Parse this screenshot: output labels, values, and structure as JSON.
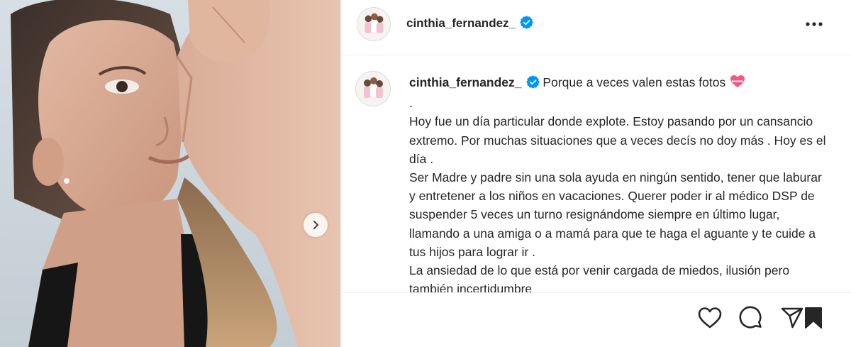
{
  "header": {
    "username": "cinthia_fernandez_",
    "verified": true,
    "avatar_icon": "profile-photo-avatar",
    "more_icon": "more-options-icon"
  },
  "caption": {
    "username": "cinthia_fernandez_",
    "verified": true,
    "first_line": "Porque a veces valen estas fotos",
    "emoji_icon": "heart-ribbon-icon",
    "body": ".\nHoy fue un día particular donde explote. Estoy pasando por un cansancio extremo. Por muchas situaciones que a veces decís no doy más . Hoy es el día .\nSer Madre y padre sin una sola ayuda en ningún sentido, tener que laburar y entretener a los niños en vacaciones. Querer poder ir al médico DSP de suspender 5 veces un turno resignándome siempre en último lugar, llamando a una amiga o a mamá para que te haga el aguante y te cuide a tus hijos para lograr ir .\nLa ansiedad de lo que está por venir cargada de miedos, ilusión pero también incertidumbre"
  },
  "media": {
    "image": "selfie-photo",
    "next_icon": "chevron-right-icon"
  },
  "actions": {
    "icons": [
      "heart-icon",
      "comment-icon",
      "share-icon",
      "bookmark-icon"
    ]
  },
  "colors": {
    "verified_blue": "#0095f6",
    "text": "#262626",
    "divider": "#efefef"
  }
}
